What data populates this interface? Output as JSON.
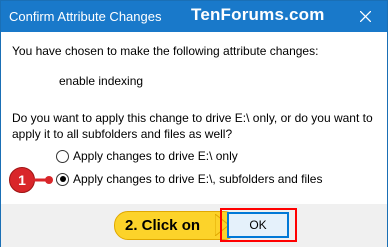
{
  "window": {
    "title": "Confirm Attribute Changes",
    "watermark": "TenForums.com"
  },
  "dialog": {
    "intro": "You have chosen to make the following attribute changes:",
    "change_item": "enable indexing",
    "question": "Do you want to apply this change to drive E:\\ only, or do you want to apply it to all subfolders and files as well?",
    "options": [
      {
        "label": "Apply changes to drive E:\\ only",
        "selected": false
      },
      {
        "label": "Apply changes to drive E:\\, subfolders and files",
        "selected": true
      }
    ],
    "ok_label": "OK"
  },
  "annotations": {
    "step1_badge": "1",
    "step2_callout": "2. Click on"
  },
  "colors": {
    "titlebar": "#1979ca",
    "badge": "#d9262a",
    "callout": "#fcd32a",
    "highlight_outline": "#ff0000"
  }
}
